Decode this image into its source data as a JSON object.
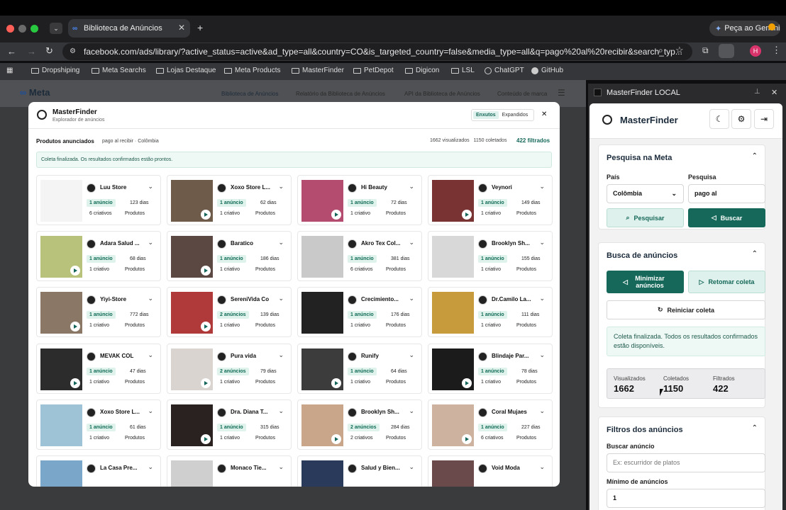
{
  "browser": {
    "tab_title": "Biblioteca de Anúncios",
    "url": "facebook.com/ads/library/?active_status=active&ad_type=all&country=CO&is_targeted_country=false&media_type=all&q=pago%20al%20recibir&search_typ...",
    "gemini_label": "Peça ao Gemini",
    "profile_initial": "H",
    "bookmarks": [
      "Dropshiping",
      "Meta Searchs",
      "Lojas Destaque",
      "Meta Products",
      "MasterFinder",
      "PetDepot",
      "Digicon",
      "LSL",
      "ChatGPT",
      "GitHub"
    ]
  },
  "meta": {
    "logo": "Meta",
    "nav": [
      "Biblioteca de Anúncios",
      "Relatório da Biblioteca de Anúncios",
      "API da Biblioteca de Anúncios",
      "Conteúdo de marca"
    ]
  },
  "modal": {
    "title": "MasterFinder",
    "subtitle": "Explorador de anúncios",
    "toggle": [
      "Enxutos",
      "Expandidos"
    ],
    "products_label": "Produtos anunciados",
    "query": "pago al recibir · Colômbia",
    "stats": "1662 visualizados   1150 coletados",
    "filtered": "422 filtrados",
    "status": "Coleta finalizada. Os resultados confirmados estão prontos.",
    "cards": [
      {
        "name": "Luu Store",
        "ads": "1 anúncio",
        "days": "123 dias",
        "creatives": "6 criativos",
        "tag": "Produtos",
        "video": false
      },
      {
        "name": "Xoxo Store L...",
        "ads": "1 anúncio",
        "days": "62 dias",
        "creatives": "1 criativo",
        "tag": "Produtos",
        "video": true
      },
      {
        "name": "Hi Beauty",
        "ads": "1 anúncio",
        "days": "72 dias",
        "creatives": "1 criativo",
        "tag": "Produtos",
        "video": true
      },
      {
        "name": "Veynori",
        "ads": "1 anúncio",
        "days": "149 dias",
        "creatives": "1 criativo",
        "tag": "Produtos",
        "video": true
      },
      {
        "name": "Adara Salud ...",
        "ads": "1 anúncio",
        "days": "68 dias",
        "creatives": "1 criativo",
        "tag": "Produtos",
        "video": true
      },
      {
        "name": "Baratico",
        "ads": "1 anúncio",
        "days": "186 dias",
        "creatives": "1 criativo",
        "tag": "Produtos",
        "video": true
      },
      {
        "name": "Akro Tex Col...",
        "ads": "1 anúncio",
        "days": "381 dias",
        "creatives": "6 criativos",
        "tag": "Produtos",
        "video": false
      },
      {
        "name": "Brooklyn Sh...",
        "ads": "1 anúncio",
        "days": "155 dias",
        "creatives": "1 criativo",
        "tag": "Produtos",
        "video": false
      },
      {
        "name": "Yiyi-Store",
        "ads": "1 anúncio",
        "days": "772 dias",
        "creatives": "1 criativo",
        "tag": "Produtos",
        "video": true
      },
      {
        "name": "SereniVida Co",
        "ads": "2 anúncios",
        "days": "139 dias",
        "creatives": "1 criativo",
        "tag": "Produtos",
        "video": true
      },
      {
        "name": "Crecimiento...",
        "ads": "1 anúncio",
        "days": "176 dias",
        "creatives": "1 criativo",
        "tag": "Produtos",
        "video": false
      },
      {
        "name": "Dr.Camilo La...",
        "ads": "1 anúncio",
        "days": "111 dias",
        "creatives": "1 criativo",
        "tag": "Produtos",
        "video": false
      },
      {
        "name": "MEVAK COL",
        "ads": "1 anúncio",
        "days": "47 dias",
        "creatives": "1 criativo",
        "tag": "Produtos",
        "video": true
      },
      {
        "name": "Pura vida",
        "ads": "2 anúncios",
        "days": "79 dias",
        "creatives": "1 criativo",
        "tag": "Produtos",
        "video": true
      },
      {
        "name": "Runify",
        "ads": "1 anúncio",
        "days": "64 dias",
        "creatives": "1 criativo",
        "tag": "Produtos",
        "video": true
      },
      {
        "name": "Blindaje Par...",
        "ads": "1 anúncio",
        "days": "78 dias",
        "creatives": "1 criativo",
        "tag": "Produtos",
        "video": true
      },
      {
        "name": "Xoxo Store L...",
        "ads": "1 anúncio",
        "days": "61 dias",
        "creatives": "1 criativo",
        "tag": "Produtos",
        "video": false
      },
      {
        "name": "Dra. Diana T...",
        "ads": "1 anúncio",
        "days": "315 dias",
        "creatives": "1 criativo",
        "tag": "Produtos",
        "video": true
      },
      {
        "name": "Brooklyn Sh...",
        "ads": "2 anúncios",
        "days": "284 dias",
        "creatives": "2 criativos",
        "tag": "Produtos",
        "video": true
      },
      {
        "name": "Coral Mujaes",
        "ads": "1 anúncio",
        "days": "227 dias",
        "creatives": "6 criativos",
        "tag": "Produtos",
        "video": true
      },
      {
        "name": "La Casa Pre...",
        "ads": "",
        "days": "",
        "creatives": "",
        "tag": "",
        "video": false
      },
      {
        "name": "Monaco Tie...",
        "ads": "",
        "days": "",
        "creatives": "",
        "tag": "",
        "video": false
      },
      {
        "name": "Salud y Bien...",
        "ads": "",
        "days": "",
        "creatives": "",
        "tag": "",
        "video": false
      },
      {
        "name": "Void Moda",
        "ads": "",
        "days": "",
        "creatives": "",
        "tag": "",
        "video": false
      }
    ]
  },
  "sidebar": {
    "window_title": "MasterFinder LOCAL",
    "app_title": "MasterFinder",
    "search_section": {
      "title": "Pesquisa na Meta",
      "country_label": "País",
      "country_value": "Colômbia",
      "query_label": "Pesquisa",
      "query_value": "pago al",
      "search_btn": "Pesquisar",
      "fetch_btn": "Buscar"
    },
    "ads_section": {
      "title": "Busca de anúncios",
      "minimize_btn": "Minimizar anúncios",
      "resume_btn": "Retomar coleta",
      "restart_btn": "Reiniciar coleta",
      "status": "Coleta finalizada. Todos os resultados confirmados estão disponíveis.",
      "stats": [
        {
          "label": "Visualizados",
          "value": "1662"
        },
        {
          "label": "Coletados",
          "value": "1150"
        },
        {
          "label": "Filtrados",
          "value": "422"
        }
      ]
    },
    "filters_section": {
      "title": "Filtros dos anúncios",
      "search_label": "Buscar anúncio",
      "search_placeholder": "Ex: escurridor de platos",
      "min_label": "Mínimo de anúncios",
      "min_value": "1"
    }
  }
}
